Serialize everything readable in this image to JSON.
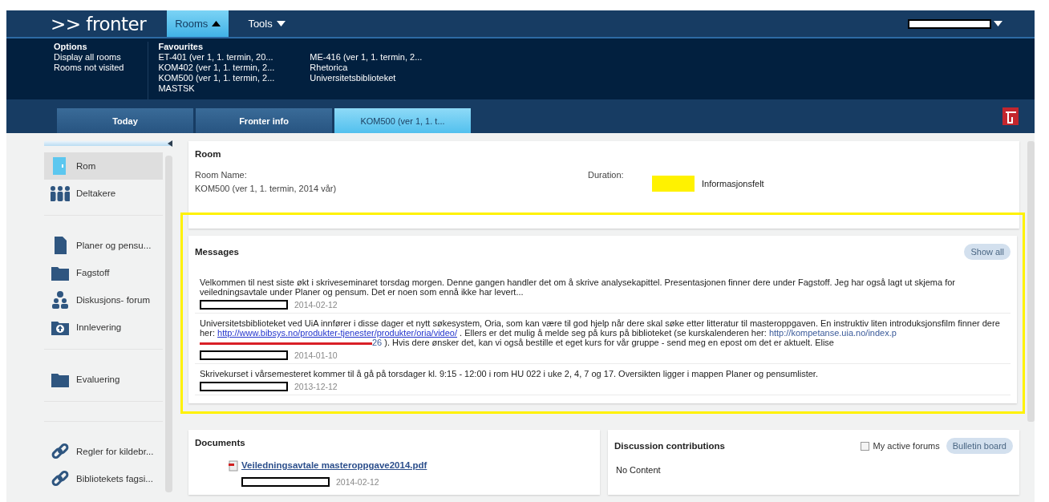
{
  "header": {
    "logo": ">> fronter",
    "menus": [
      {
        "label": "Rooms",
        "selected": true,
        "expanded": true
      },
      {
        "label": "Tools",
        "selected": false,
        "expanded": false
      }
    ]
  },
  "rooms_menu": {
    "options_title": "Options",
    "options": [
      "Display all rooms",
      "Rooms not visited"
    ],
    "favourites_title": "Favourites",
    "favourites": [
      [
        "ET-401 (ver 1, 1. termin, 20...",
        "KOM402 (ver 1, 1. termin, 2...",
        "KOM500 (ver 1, 1. termin, 2...",
        "MASTSK"
      ],
      [
        "ME-416 (ver 1, 1. termin, 2...",
        "Rhetorica",
        "Universitetsbiblioteket"
      ]
    ]
  },
  "tabs": [
    {
      "label": "Today",
      "selected": false
    },
    {
      "label": "Fronter info",
      "selected": false
    },
    {
      "label": "KOM500 (ver 1, 1. t...",
      "selected": true
    }
  ],
  "sidebar": {
    "groups": [
      [
        {
          "kind": "room",
          "label": "Rom",
          "selected": true
        },
        {
          "kind": "people",
          "label": "Deltakere",
          "selected": false
        }
      ],
      [
        {
          "kind": "document",
          "label": "Planer og pensu...",
          "selected": false
        },
        {
          "kind": "folder",
          "label": "Fagstoff",
          "selected": false
        },
        {
          "kind": "forum",
          "label": "Diskusjons- forum",
          "selected": false
        },
        {
          "kind": "upload",
          "label": "Innlevering",
          "selected": false
        }
      ],
      [
        {
          "kind": "folder",
          "label": "Evaluering",
          "selected": false
        }
      ],
      [
        {
          "kind": "link",
          "label": "Regler for kildebr...",
          "selected": false
        },
        {
          "kind": "link",
          "label": "Bibliotekets fagsi...",
          "selected": false
        }
      ]
    ]
  },
  "room": {
    "title": "Room",
    "name_label": "Room Name:",
    "name_value": "KOM500 (ver 1, 1. termin, 2014 vår)",
    "duration_label": "Duration:",
    "info_label": "Informasjonsfelt"
  },
  "messages": {
    "title": "Messages",
    "show_all": "Show all",
    "items": [
      {
        "date": "2014-02-12",
        "parts": [
          {
            "kind": "text",
            "text": "Velkommen til nest siste økt i skriveseminaret torsdag morgen. Denne gangen handler det om å skrive analysekapittel. Presentasjonen finner dere under Fagstoff. Jeg har også lagt ut skjema for veiledningsavtale under Planer og pensum. Det er noen som ennå ikke har levert..."
          }
        ]
      },
      {
        "date": "2014-01-10",
        "parts": [
          {
            "kind": "text",
            "text": "Universitetsbiblioteket ved UiA innfører i disse dager et nytt søkesystem, Oria, som kan være til god hjelp når dere skal søke etter litteratur til masteroppgaven. En instruktiv liten introduksjonsfilm finner dere her: "
          },
          {
            "kind": "link",
            "text": "http://www.bibsys.no/produkter-tjenester/produkter/oria/video/"
          },
          {
            "kind": "text",
            "text": " . Ellers er det mulig å melde seg på kurs på biblioteket (se kurskalenderen her: "
          },
          {
            "kind": "plainlink",
            "text": "http://kompetanse.uia.no/index.p"
          },
          {
            "kind": "struck"
          },
          {
            "kind": "plainlink",
            "text": "26"
          },
          {
            "kind": "text",
            "text": " ). Hvis dere ønsker det, kan vi også bestille et eget kurs for vår gruppe - send meg en epost om det er aktuelt. Elise"
          }
        ]
      },
      {
        "date": "2013-12-12",
        "parts": [
          {
            "kind": "text",
            "text": "Skrivekurset i vårsemesteret kommer til å gå på torsdager kl. 9:15 - 12:00 i rom HU 022 i uke 2, 4, 7 og 17. Oversikten ligger i mappen Planer og pensumlister."
          }
        ]
      }
    ]
  },
  "documents": {
    "title": "Documents",
    "items": [
      {
        "name": "Veiledningsavtale masteroppgave2014.pdf",
        "date": "2014-02-12"
      }
    ]
  },
  "discussion": {
    "title": "Discussion contributions",
    "filter": {
      "label": "My active forums",
      "checked": false
    },
    "button": "Bulletin board",
    "empty": "No Content"
  }
}
